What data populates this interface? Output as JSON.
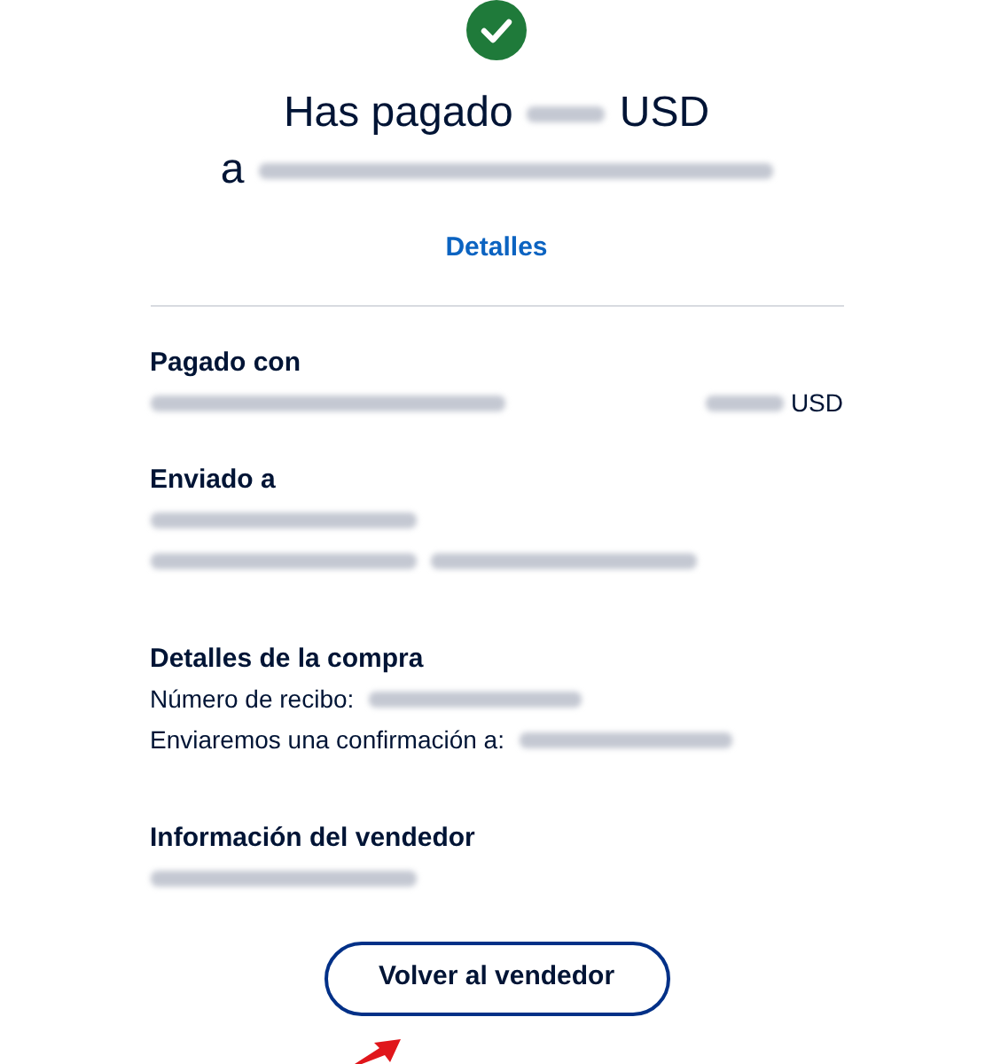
{
  "status_icon": {
    "kind": "success"
  },
  "heading": {
    "amount_prefix": "Has pagado",
    "amount_suffix": "USD",
    "recipient_prefix": "a"
  },
  "details_link": "Detalles",
  "sections": [
    {
      "title": "Pagado con",
      "lines": [
        {
          "kind": "split",
          "segments": [
            {
              "kind": "redacted"
            },
            {
              "kind": "redacted"
            },
            {
              "kind": "text",
              "text": "USD"
            }
          ]
        }
      ]
    },
    {
      "title": "Enviado a",
      "lines": [
        {
          "kind": "plain",
          "segments": [
            {
              "kind": "redacted"
            }
          ]
        },
        {
          "kind": "plain",
          "segments": [
            {
              "kind": "redacted"
            },
            {
              "kind": "redacted"
            }
          ]
        }
      ]
    },
    {
      "title": "Detalles de la compra",
      "lines": [
        {
          "kind": "plain",
          "segments": [
            {
              "kind": "text",
              "text": "Número de recibo:"
            },
            {
              "kind": "redacted"
            }
          ]
        },
        {
          "kind": "plain",
          "segments": [
            {
              "kind": "text",
              "text": "Enviaremos una confirmación a:"
            },
            {
              "kind": "redacted"
            }
          ]
        }
      ]
    },
    {
      "title": "Información del vendedor",
      "lines": [
        {
          "kind": "plain",
          "segments": [
            {
              "kind": "redacted"
            }
          ]
        }
      ]
    }
  ],
  "return_button": "Volver al vendedor",
  "annotation": {
    "kind": "arrow"
  }
}
